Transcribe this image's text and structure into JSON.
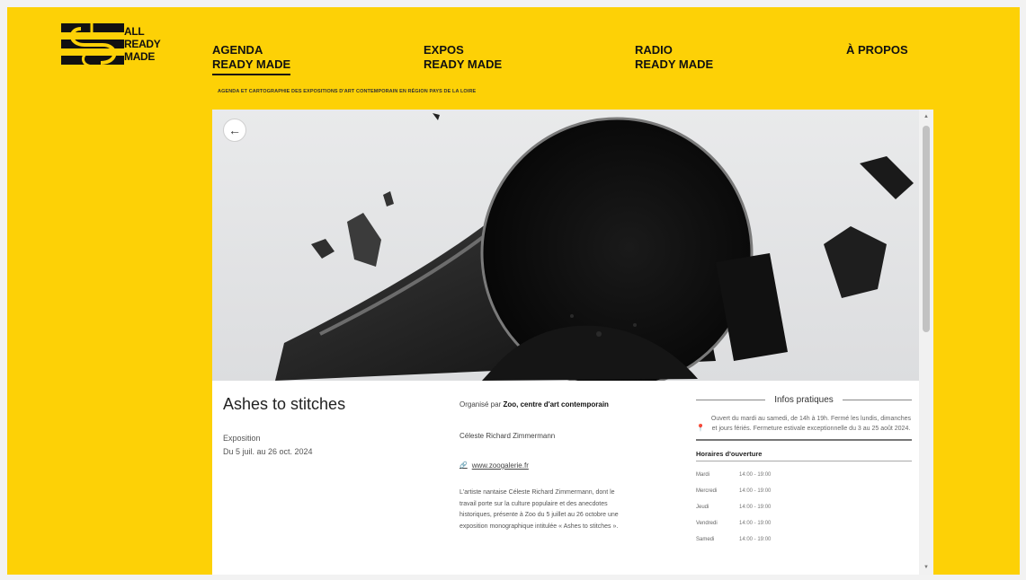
{
  "logo": {
    "line1": "ALL",
    "line2": "READY",
    "line3": "MADE"
  },
  "nav": [
    {
      "line1": "AGENDA",
      "line2": "READY MADE",
      "active": true
    },
    {
      "line1": "EXPOS",
      "line2": "READY MADE",
      "active": false
    },
    {
      "line1": "RADIO",
      "line2": "READY MADE",
      "active": false
    },
    {
      "line1": "",
      "line2": "À PROPOS",
      "active": false
    }
  ],
  "tagline": "AGENDA ET CARTOGRAPHIE DES EXPOSITIONS D'ART CONTEMPORAIN EN RÉGION PAYS DE LA LOIRE",
  "back_icon": "←",
  "event": {
    "title": "Ashes to stitches",
    "type": "Exposition",
    "dates": "Du 5 juil. au 26 oct. 2024"
  },
  "organizer": {
    "prefix": "Organisé par ",
    "name": "Zoo, centre d'art contemporain",
    "artist": "Céleste Richard Zimmermann",
    "link_icon": "🔗",
    "link": "www.zoogalerie.fr",
    "description": "L'artiste nantaise Céleste Richard Zimmermann, dont le travail porte sur la culture populaire et des anecdotes historiques, présente à Zoo du 5 juillet au 26 octobre une exposition monographique intitulée « Ashes to stitches »."
  },
  "infos": {
    "heading": "Infos pratiques",
    "pin_icon": "📍",
    "text": "Ouvert du mardi au samedi, de 14h à 19h. Fermé les lundis, dimanches et jours fériés. Fermeture estivale exceptionnelle du 3 au 25 août 2024.",
    "hours_title": "Horaires d'ouverture",
    "hours": [
      {
        "day": "Mardi",
        "time": "14:00 - 19:00"
      },
      {
        "day": "Mercredi",
        "time": "14:00 - 19:00"
      },
      {
        "day": "Jeudi",
        "time": "14:00 - 19:00"
      },
      {
        "day": "Vendredi",
        "time": "14:00 - 19:00"
      },
      {
        "day": "Samedi",
        "time": "14:00 - 19:00"
      }
    ]
  },
  "colors": {
    "brand": "#fdd106",
    "ink": "#111111"
  }
}
